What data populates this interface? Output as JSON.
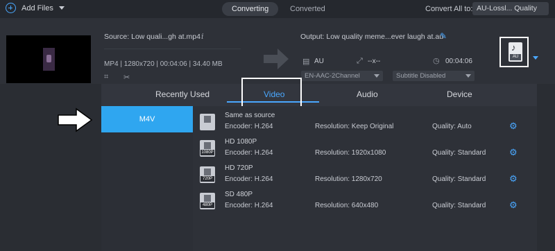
{
  "toolbar": {
    "add_files_label": "Add Files",
    "tabs": [
      "Converting",
      "Converted"
    ],
    "convert_all_label": "Convert All to:",
    "convert_all_value": "AU-Lossl... Quality"
  },
  "file": {
    "source_label": "Source: Low quali...gh at.mp4",
    "meta": "MP4 | 1280x720 | 00:04:06 | 34.40 MB",
    "output_label": "Output: Low quality meme...ever laugh at.au",
    "audio_format": "AU",
    "resolution": "--x--",
    "duration": "00:04:06",
    "audio_track": "EN-AAC-2Channel",
    "subtitle": "Subtitle Disabled",
    "format_badge": "AU"
  },
  "panel": {
    "tabs": [
      "Recently Used",
      "Video",
      "Audio",
      "Device"
    ],
    "selected_format": "M4V",
    "presets": [
      {
        "name": "Same as source",
        "badge": "",
        "encoder": "Encoder: H.264",
        "resolution": "Resolution: Keep Original",
        "quality": "Quality: Auto"
      },
      {
        "name": "HD 1080P",
        "badge": "1080P",
        "encoder": "Encoder: H.264",
        "resolution": "Resolution: 1920x1080",
        "quality": "Quality: Standard"
      },
      {
        "name": "HD 720P",
        "badge": "720P",
        "encoder": "Encoder: H.264",
        "resolution": "Resolution: 1280x720",
        "quality": "Quality: Standard"
      },
      {
        "name": "SD 480P",
        "badge": "480P",
        "encoder": "Encoder: H.264",
        "resolution": "Resolution: 640x480",
        "quality": "Quality: Standard"
      }
    ]
  },
  "colors": {
    "accent": "#2fa6f0",
    "background": "#2a2d33",
    "panel": "#33363e"
  },
  "icons": [
    "add-icon",
    "info-icon",
    "edit-icon",
    "gear-icon",
    "cut-icon",
    "clock-icon"
  ]
}
